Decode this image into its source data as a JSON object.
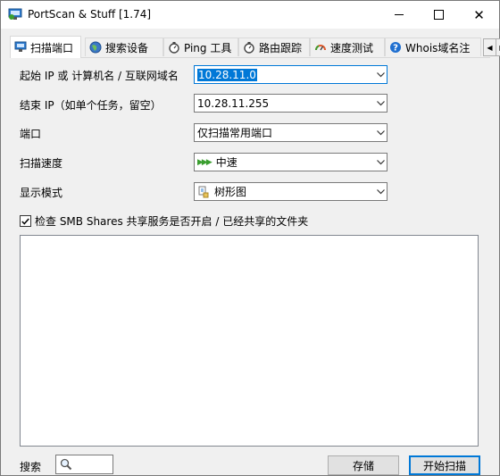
{
  "window": {
    "title": "PortScan & Stuff [1.74]",
    "controls": {
      "minimize": "–",
      "maximize": "☐",
      "close": "✕"
    }
  },
  "tabs": [
    {
      "label": "扫描端口",
      "icon": "network-scan-icon",
      "active": true
    },
    {
      "label": "搜索设备",
      "icon": "globe-icon",
      "active": false
    },
    {
      "label": "Ping 工具",
      "icon": "stopwatch-icon",
      "active": false
    },
    {
      "label": "路由跟踪",
      "icon": "stopwatch-icon",
      "active": false
    },
    {
      "label": "速度测试",
      "icon": "speedometer-icon",
      "active": false
    },
    {
      "label": "Whois域名注",
      "icon": "help-icon",
      "active": false
    }
  ],
  "form": {
    "start_ip": {
      "label": "起始 IP 或 计算机名 / 互联网域名",
      "value": "10.28.11.0"
    },
    "end_ip": {
      "label": "结束 IP（如单个任务，留空）",
      "value": "10.28.11.255"
    },
    "port": {
      "label": "端口",
      "value": "仅扫描常用端口"
    },
    "scan_speed": {
      "label": "扫描速度",
      "value": "中速"
    },
    "display_mode": {
      "label": "显示模式",
      "value": "树形图"
    },
    "smb_check": {
      "label": "检查 SMB Shares 共享服务是否开启 / 已经共享的文件夹",
      "checked": true
    }
  },
  "bottom": {
    "search_label": "搜索",
    "save_button": "存储",
    "start_button": "开始扫描"
  },
  "colors": {
    "accent": "#0078d7",
    "window_bg": "#f0f0f0",
    "speed_green": "#3a9e2f"
  }
}
